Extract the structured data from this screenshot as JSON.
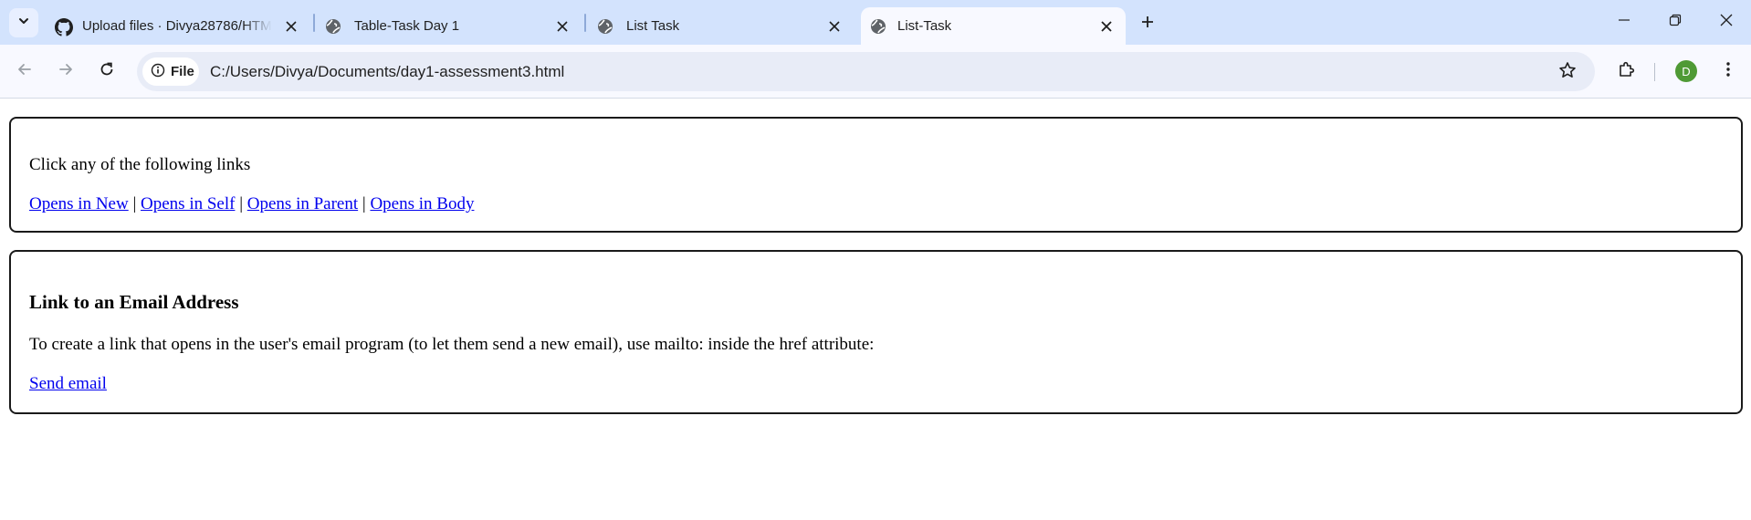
{
  "browser": {
    "tabs": [
      {
        "title": "Upload files · Divya28786/HTML",
        "favicon": "github-icon",
        "active": false
      },
      {
        "title": "Table-Task Day 1",
        "favicon": "globe-icon",
        "active": false
      },
      {
        "title": "List Task",
        "favicon": "globe-icon",
        "active": false
      },
      {
        "title": "List-Task",
        "favicon": "globe-icon",
        "active": true
      }
    ],
    "site_chip_label": "File",
    "url": "C:/Users/Divya/Documents/day1-assessment3.html",
    "profile_initial": "D",
    "colors": {
      "tabstrip_bg": "#d3e3fd",
      "toolbar_bg": "#f8f9ff",
      "avatar_bg": "#4f9a35",
      "link": "#0000ee"
    }
  },
  "page": {
    "section1": {
      "intro": "Click any of the following links",
      "links": [
        "Opens in New",
        "Opens in Self",
        "Opens in Parent",
        "Opens in Body"
      ],
      "separator": "|"
    },
    "section2": {
      "heading": "Link to an Email Address",
      "description": "To create a link that opens in the user's email program (to let them send a new email), use mailto: inside the href attribute:",
      "link": "Send email"
    }
  }
}
